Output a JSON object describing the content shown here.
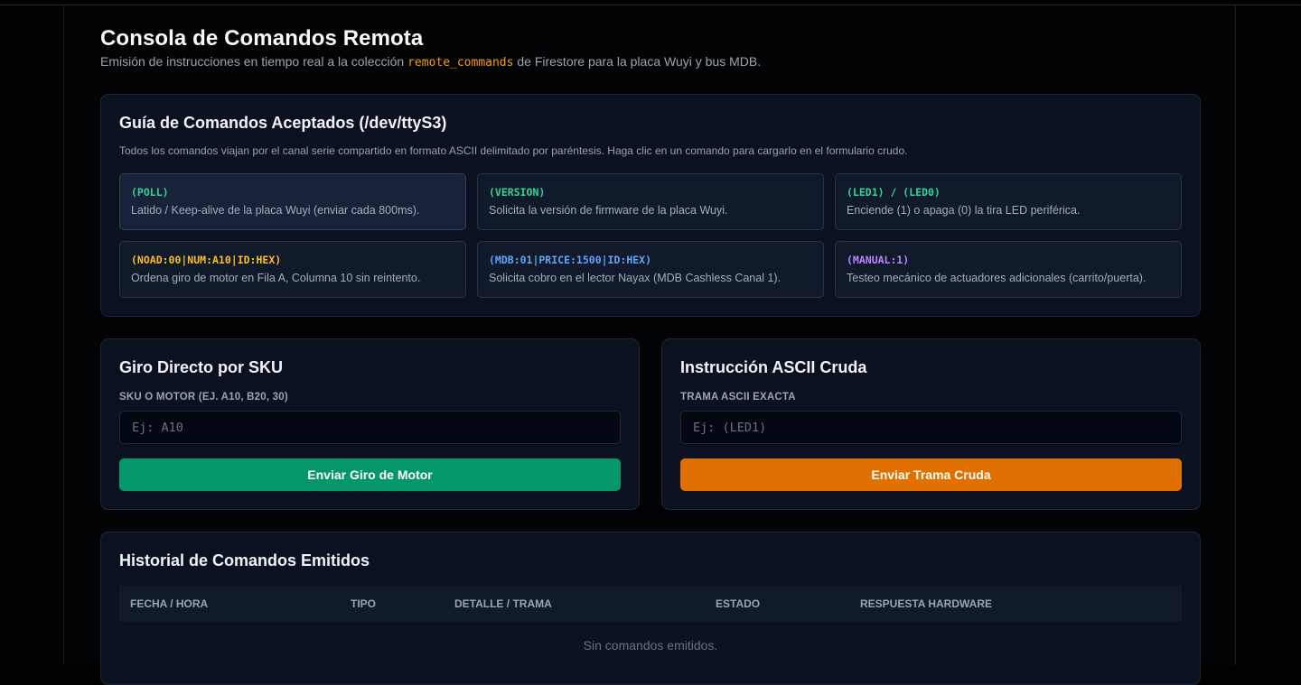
{
  "header": {
    "title": "Consola de Comandos Remota",
    "subtitle_prefix": "Emisión de instrucciones en tiempo real a la colección",
    "subtitle_code": "remote_commands",
    "subtitle_suffix": "de Firestore para la placa Wuyi y bus MDB."
  },
  "guide": {
    "title": "Guía de Comandos Aceptados (/dev/ttyS3)",
    "description": "Todos los comandos viajan por el canal serie compartido en formato ASCII delimitado por paréntesis. Haga clic en un comando para cargarlo en el formulario crudo.",
    "commands": [
      {
        "code": "(POLL)",
        "desc": "Latido / Keep-alive de la placa Wuyi (enviar cada 800ms).",
        "color": "#34d399"
      },
      {
        "code": "(VERSION)",
        "desc": "Solicita la versión de firmware de la placa Wuyi.",
        "color": "#34d399"
      },
      {
        "code": "(LED1) / (LED0)",
        "desc": "Enciende (1) o apaga (0) la tira LED periférica.",
        "color": "#34d399"
      },
      {
        "code": "(NOAD:00|NUM:A10|ID:HEX)",
        "desc": "Ordena giro de motor en Fila A, Columna 10 sin reintento.",
        "color": "#fbbf24"
      },
      {
        "code": "(MDB:01|PRICE:1500|ID:HEX)",
        "desc": "Solicita cobro en el lector Nayax (MDB Cashless Canal 1).",
        "color": "#60a5fa"
      },
      {
        "code": "(MANUAL:1)",
        "desc": "Testeo mecánico de actuadores adicionales (carrito/puerta).",
        "color": "#c084fc"
      }
    ]
  },
  "sku_panel": {
    "title": "Giro Directo por SKU",
    "label": "SKU o Motor (Ej. A10, B20, 30)",
    "placeholder": "Ej: A10",
    "value": "",
    "button": "Enviar Giro de Motor"
  },
  "raw_panel": {
    "title": "Instrucción ASCII Cruda",
    "label": "Trama ASCII Exacta",
    "placeholder": "Ej: (LED1)",
    "value": "",
    "button": "Enviar Trama Cruda"
  },
  "history": {
    "title": "Historial de Comandos Emitidos",
    "columns": [
      "Fecha / Hora",
      "Tipo",
      "Detalle / Trama",
      "Estado",
      "Respuesta Hardware"
    ],
    "empty_text": "Sin comandos emitidos."
  },
  "colors": {
    "background": "#000000",
    "panel": "#0b1120",
    "accent_green": "#059669",
    "accent_orange": "#e07000",
    "code_yellow": "#f59e0b"
  }
}
